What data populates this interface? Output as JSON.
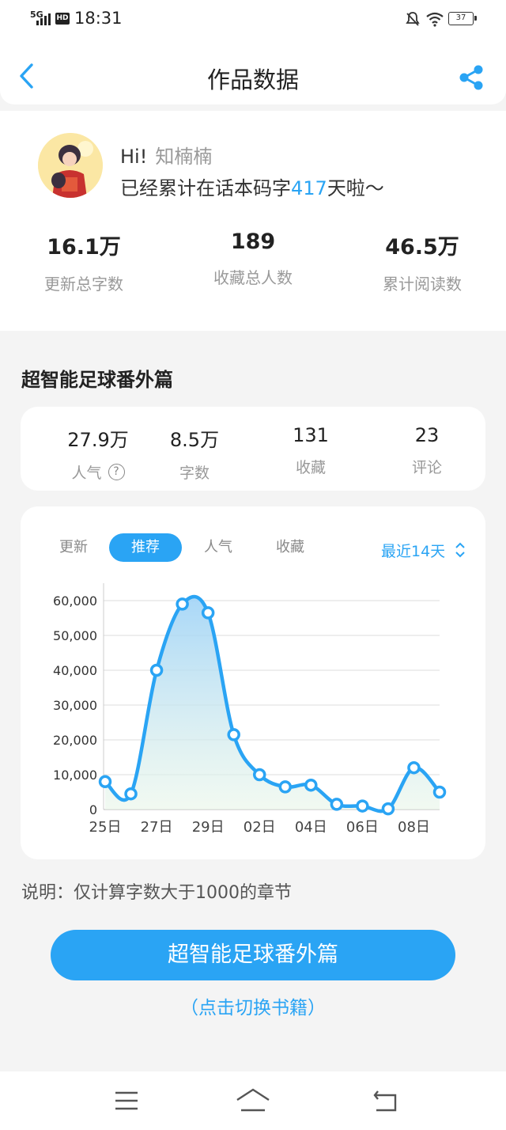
{
  "status": {
    "signal": "5G",
    "hd": "HD",
    "time": "18:31",
    "battery": "37"
  },
  "header": {
    "title": "作品数据"
  },
  "profile": {
    "greeting": "Hi!",
    "name": "知楠楠",
    "days_prefix": "已经累计在话本码字",
    "days": "417",
    "days_suffix": "天啦～"
  },
  "totals": [
    {
      "value": "16.1万",
      "label": "更新总字数"
    },
    {
      "value": "189",
      "label": "收藏总人数"
    },
    {
      "value": "46.5万",
      "label": "累计阅读数"
    }
  ],
  "book": {
    "title": "超智能足球番外篇"
  },
  "book_stats": [
    {
      "value": "27.9万",
      "label": "人气",
      "help": "?"
    },
    {
      "value": "8.5万",
      "label": "字数"
    },
    {
      "value": "131",
      "label": "收藏"
    },
    {
      "value": "23",
      "label": "评论"
    }
  ],
  "tabs": [
    {
      "label": "更新",
      "active": false
    },
    {
      "label": "推荐",
      "active": true
    },
    {
      "label": "人气",
      "active": false
    },
    {
      "label": "收藏",
      "active": false
    }
  ],
  "range": {
    "label": "最近14天"
  },
  "chart_data": {
    "type": "area",
    "x": [
      "25日",
      "26日",
      "27日",
      "28日",
      "29日",
      "30日",
      "02日",
      "03日",
      "04日",
      "05日",
      "06日",
      "07日",
      "08日",
      "09日"
    ],
    "xticks": [
      "25日",
      "27日",
      "29日",
      "02日",
      "04日",
      "06日",
      "08日"
    ],
    "values": [
      8000,
      4500,
      40000,
      59000,
      56500,
      21500,
      10000,
      6500,
      7000,
      1500,
      1000,
      200,
      12000,
      5000
    ],
    "yticks": [
      "0",
      "10,000",
      "20,000",
      "30,000",
      "40,000",
      "50,000",
      "60,000"
    ],
    "ylim": [
      0,
      60000
    ],
    "grid": true,
    "color": "#2aa4f4"
  },
  "note": "说明：仅计算字数大于1000的章节",
  "switch_button": {
    "label": "超智能足球番外篇"
  },
  "switch_link": "（点击切换书籍）"
}
